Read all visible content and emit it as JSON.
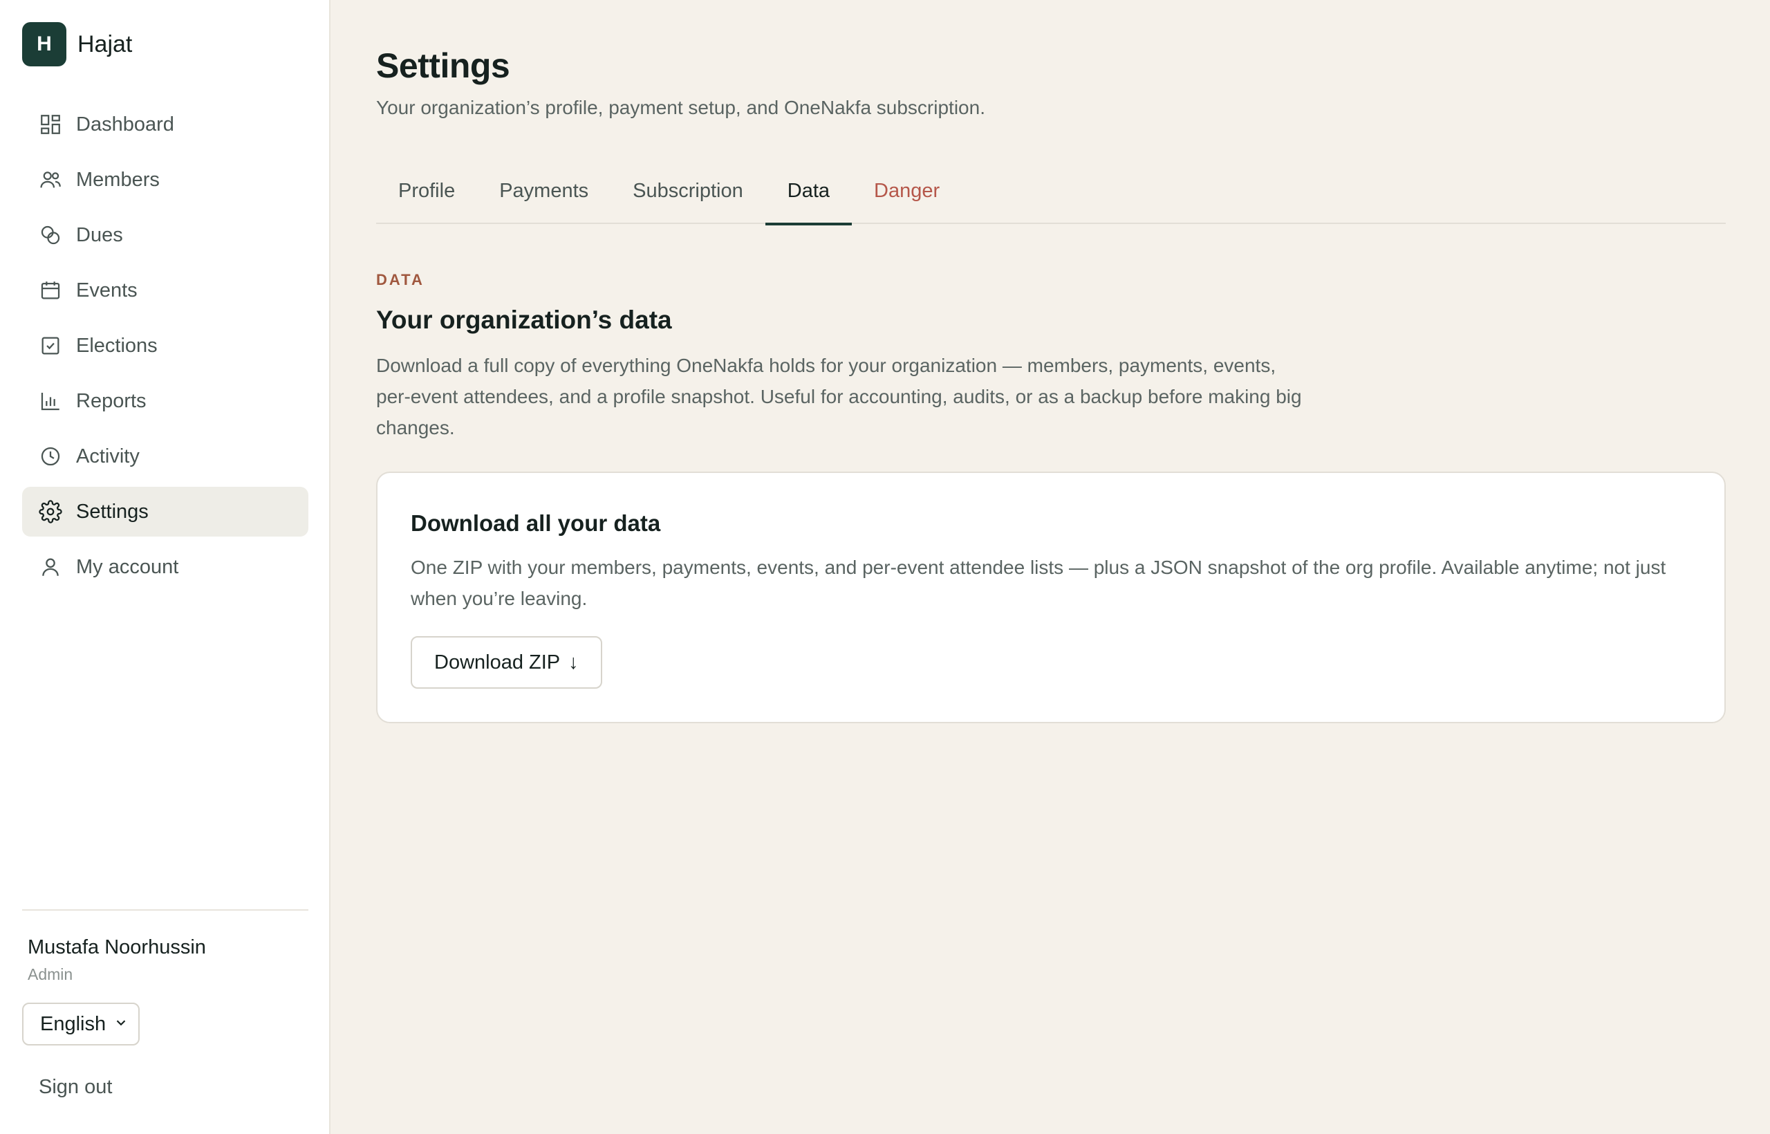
{
  "brand": {
    "initial": "H",
    "name": "Hajat"
  },
  "sidebar": {
    "items": [
      {
        "label": "Dashboard",
        "icon": "dashboard-icon"
      },
      {
        "label": "Members",
        "icon": "members-icon"
      },
      {
        "label": "Dues",
        "icon": "dues-icon"
      },
      {
        "label": "Events",
        "icon": "calendar-icon"
      },
      {
        "label": "Elections",
        "icon": "checkbox-icon"
      },
      {
        "label": "Reports",
        "icon": "bar-chart-icon"
      },
      {
        "label": "Activity",
        "icon": "clock-icon"
      },
      {
        "label": "Settings",
        "icon": "gear-icon",
        "active": true
      },
      {
        "label": "My account",
        "icon": "user-icon"
      }
    ]
  },
  "user": {
    "name": "Mustafa Noorhussin",
    "role": "Admin"
  },
  "language": {
    "selected": "English"
  },
  "signout_label": "Sign out",
  "page": {
    "title": "Settings",
    "subtitle": "Your organization’s profile, payment setup, and OneNakfa subscription."
  },
  "tabs": [
    {
      "label": "Profile"
    },
    {
      "label": "Payments"
    },
    {
      "label": "Subscription"
    },
    {
      "label": "Data",
      "active": true
    },
    {
      "label": "Danger",
      "danger": true
    }
  ],
  "data_section": {
    "eyebrow": "DATA",
    "title": "Your organization’s data",
    "description": "Download a full copy of everything OneNakfa holds for your organization — members, payments, events, per-event attendees, and a profile snapshot. Useful for accounting, audits, or as a backup before making big changes."
  },
  "download_card": {
    "title": "Download all your data",
    "description": "One ZIP with your members, payments, events, and per-event attendee lists — plus a JSON snapshot of the org profile. Available anytime; not just when you’re leaving.",
    "button_label": "Download ZIP",
    "button_arrow": "↓"
  },
  "colors": {
    "brand": "#1b3d36",
    "background": "#f5f1ea",
    "danger": "#b5574a",
    "eyebrow": "#a0583f"
  }
}
